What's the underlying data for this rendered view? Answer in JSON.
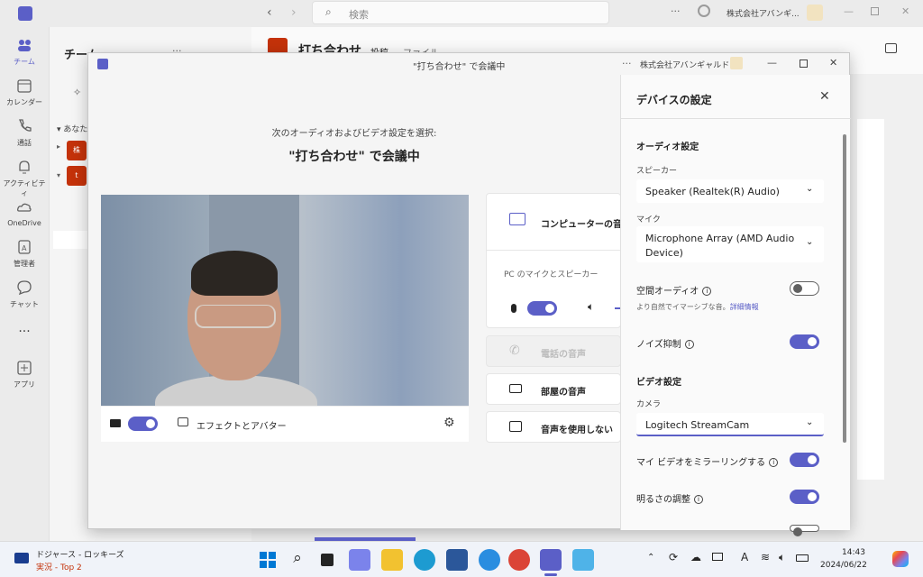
{
  "app": {
    "search_placeholder": "検索",
    "org_name": "株式会社アバンギ..."
  },
  "rail": [
    {
      "label": "チーム",
      "icon": "teams-icon"
    },
    {
      "label": "カレンダー",
      "icon": "calendar-icon"
    },
    {
      "label": "通話",
      "icon": "phone-icon"
    },
    {
      "label": "アクティビティ",
      "icon": "bell-icon"
    },
    {
      "label": "OneDrive",
      "icon": "cloud-icon"
    },
    {
      "label": "管理者",
      "icon": "admin-icon"
    },
    {
      "label": "チャット",
      "icon": "chat-icon"
    },
    {
      "label": "アプリ",
      "icon": "apps-icon"
    }
  ],
  "teams_panel": {
    "title": "チーム",
    "section": "あなた",
    "team1_avatar": "株",
    "team2_avatar": "t"
  },
  "channel": {
    "title": "打ち合わせ",
    "tab_posts": "投稿",
    "tab_files": "ファイル"
  },
  "dialog": {
    "title": "\"打ち合わせ\" で会議中",
    "org": "株式会社アバンギャルド",
    "subtitle": "次のオーディオおよびビデオ設定を選択:",
    "meeting_name": "\"打ち合わせ\" で会議中",
    "effects_label": "エフェクトとアバター",
    "audio_options": {
      "computer_audio": "コンピューターの音声",
      "pc_mic_speaker": "PC のマイクとスピーカー",
      "phone_audio": "電話の音声",
      "room_audio": "部屋の音声",
      "no_audio": "音声を使用しない"
    }
  },
  "device_settings": {
    "title": "デバイスの設定",
    "audio_section": "オーディオ設定",
    "speaker_label": "スピーカー",
    "speaker_value": "Speaker (Realtek(R) Audio)",
    "mic_label": "マイク",
    "mic_value": "Microphone Array (AMD Audio Device)",
    "spatial_audio": "空間オーディオ",
    "spatial_desc": "より自然でイマーシブな音。",
    "spatial_link": "詳細情報",
    "noise_suppression": "ノイズ抑制",
    "video_section": "ビデオ設定",
    "camera_label": "カメラ",
    "camera_value": "Logitech StreamCam",
    "mirror_video": "マイ ビデオをミラーリングする",
    "brightness": "明るさの調整",
    "toggles": {
      "camera": true,
      "mic": true,
      "spatial_audio": false,
      "noise_suppression": true,
      "mirror": true,
      "brightness": true
    }
  },
  "taskbar": {
    "news_title": "ドジャース - ロッキーズ",
    "news_sub": "実況 - Top 2",
    "time": "14:43",
    "date": "2024/06/22"
  },
  "colors": {
    "accent": "#5b5fc7",
    "teams_red": "#c4320a"
  }
}
